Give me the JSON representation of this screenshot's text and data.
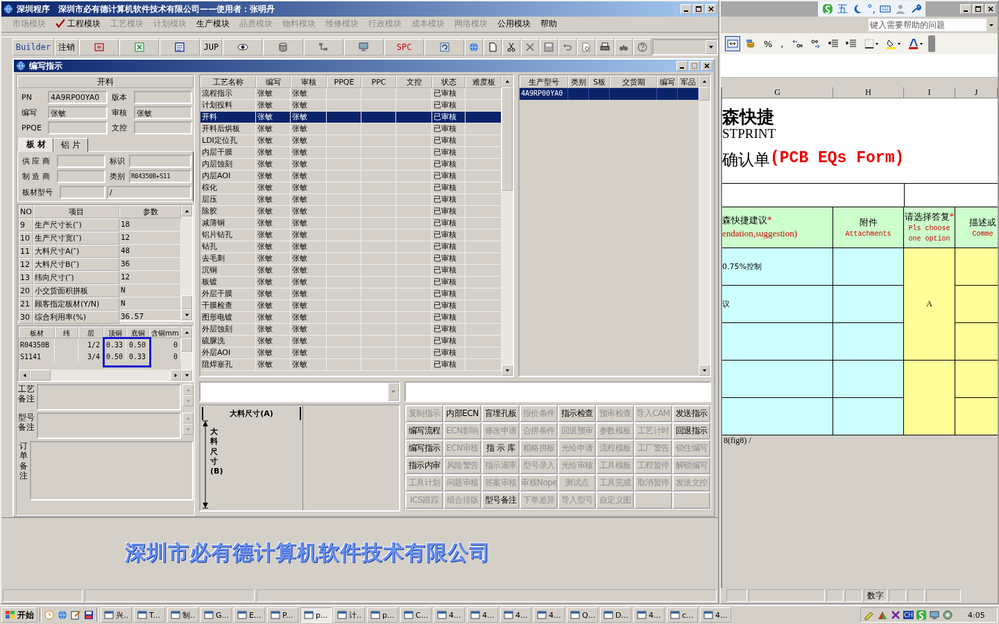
{
  "main_window": {
    "title": "深圳程序　深圳市必有德计算机软件技术有限公司——使用者：张明丹",
    "menu": [
      {
        "label": "市场模块",
        "disabled": true,
        "checked": false
      },
      {
        "label": "工程模块",
        "disabled": false,
        "checked": true
      },
      {
        "label": "工艺模块",
        "disabled": true,
        "checked": false
      },
      {
        "label": "计划模块",
        "disabled": true,
        "checked": false
      },
      {
        "label": "生产模块",
        "disabled": false,
        "checked": false
      },
      {
        "label": "品质模块",
        "disabled": true,
        "checked": false
      },
      {
        "label": "物料模块",
        "disabled": true,
        "checked": false
      },
      {
        "label": "维修模块",
        "disabled": true,
        "checked": false
      },
      {
        "label": "行政模块",
        "disabled": true,
        "checked": false
      },
      {
        "label": "成本模块",
        "disabled": true,
        "checked": false
      },
      {
        "label": "网络模块",
        "disabled": true,
        "checked": false
      },
      {
        "label": "公用模块",
        "disabled": false,
        "checked": false
      },
      {
        "label": "帮助",
        "disabled": false,
        "checked": false
      }
    ],
    "toolbar": [
      {
        "kind": "text",
        "label": "Builder"
      },
      {
        "kind": "text",
        "label": "注销"
      },
      {
        "kind": "icon"
      },
      {
        "kind": "icon"
      },
      {
        "kind": "icon"
      },
      {
        "kind": "text",
        "label": "JUP"
      },
      {
        "kind": "icon"
      },
      {
        "kind": "icon"
      },
      {
        "kind": "icon"
      },
      {
        "kind": "icon"
      },
      {
        "kind": "text",
        "label": "SPC"
      },
      {
        "kind": "icon"
      },
      {
        "kind": "icon"
      },
      {
        "kind": "icon"
      },
      {
        "kind": "icon"
      },
      {
        "kind": "icon"
      },
      {
        "kind": "icon"
      },
      {
        "kind": "icon"
      },
      {
        "kind": "icon"
      },
      {
        "kind": "icon"
      },
      {
        "kind": "icon"
      },
      {
        "kind": "icon"
      }
    ],
    "banner": "深圳市必有德计算机软件技术有限公司"
  },
  "child_window": {
    "title": "编写指示",
    "left_panel": {
      "header": "开料",
      "fields": [
        {
          "label": "PN",
          "value": "4A9RP00YA0"
        },
        {
          "label": "版本"
        },
        {
          "label": "编写",
          "value": "张敏"
        },
        {
          "label": "审核",
          "value": "张敏"
        },
        {
          "label": "PPQE"
        },
        {
          "label": "文控"
        }
      ],
      "tabs": [
        {
          "label": "板 材",
          "selected": true
        },
        {
          "label": "铝 片",
          "selected": false
        }
      ],
      "material_fields": [
        {
          "label": "供 应 商"
        },
        {
          "label": "标识"
        },
        {
          "label": "制 造 商"
        },
        {
          "label": "类别",
          "value": "R04350B+S11"
        }
      ],
      "board_model": {
        "label": "板材型号",
        "value_2": "/"
      },
      "params": {
        "columns": [
          "NO",
          "项目",
          "参数"
        ],
        "rows": [
          [
            "9",
            "生产尺寸长(″)",
            "18"
          ],
          [
            "10",
            "生产尺寸宽(″)",
            "12"
          ],
          [
            "11",
            "大料尺寸A(″)",
            "48"
          ],
          [
            "12",
            "大料尺寸B(″)",
            "36"
          ],
          [
            "13",
            "纬向尺寸(″)",
            "12"
          ],
          [
            "20",
            "小交货面积拼板",
            "N"
          ],
          [
            "21",
            "顾客指定板材(Y/N)",
            "N"
          ],
          [
            "30",
            "综合利用率(%)",
            "36.57"
          ]
        ]
      },
      "materials": {
        "columns": [
          "板材",
          "纬",
          "层",
          "顶铜",
          "底铜",
          "含铜mm"
        ],
        "rows": [
          [
            "R04350B",
            "",
            "1/2",
            "0.33",
            "0.50",
            "0"
          ],
          [
            "S1141",
            "",
            "3/4",
            "0.50",
            "0.33",
            "0"
          ]
        ]
      },
      "remarks": [
        {
          "label": "工艺备注",
          "kind": "small"
        },
        {
          "label": "型号备注",
          "kind": "small"
        },
        {
          "label": "订单备注",
          "kind": "large"
        }
      ]
    },
    "process_table": {
      "columns": [
        "工艺名称",
        "编写",
        "审核",
        "PPQE",
        "PPC",
        "文控",
        "状态",
        "难度板"
      ],
      "rows": [
        {
          "name": "流程指示",
          "writer": "张敏",
          "reviewer": "张敏",
          "status": "已审核",
          "selected": false
        },
        {
          "name": "计划投料",
          "writer": "张敏",
          "reviewer": "张敏",
          "status": "已审核",
          "selected": false
        },
        {
          "name": "开料",
          "writer": "张敏",
          "reviewer": "张敏",
          "status": "已审核",
          "selected": true
        },
        {
          "name": "开料后烘板",
          "writer": "张敏",
          "reviewer": "张敏",
          "status": "已审核",
          "selected": false
        },
        {
          "name": "LDI定位孔",
          "writer": "张敏",
          "reviewer": "张敏",
          "status": "已审核",
          "selected": false
        },
        {
          "name": "内层干膜",
          "writer": "张敏",
          "reviewer": "张敏",
          "status": "已审核",
          "selected": false
        },
        {
          "name": "内层蚀刻",
          "writer": "张敏",
          "reviewer": "张敏",
          "status": "已审核",
          "selected": false
        },
        {
          "name": "内层AOI",
          "writer": "张敏",
          "reviewer": "张敏",
          "status": "已审核",
          "selected": false
        },
        {
          "name": "棕化",
          "writer": "张敏",
          "reviewer": "张敏",
          "status": "已审核",
          "selected": false
        },
        {
          "name": "层压",
          "writer": "张敏",
          "reviewer": "张敏",
          "status": "已审核",
          "selected": false
        },
        {
          "name": "除胶",
          "writer": "张敏",
          "reviewer": "张敏",
          "status": "已审核",
          "selected": false
        },
        {
          "name": "减薄铜",
          "writer": "张敏",
          "reviewer": "张敏",
          "status": "已审核",
          "selected": false
        },
        {
          "name": "铝片钻孔",
          "writer": "张敏",
          "reviewer": "张敏",
          "status": "已审核",
          "selected": false
        },
        {
          "name": "钻孔",
          "writer": "张敏",
          "reviewer": "张敏",
          "status": "已审核",
          "selected": false
        },
        {
          "name": "去毛刺",
          "writer": "张敏",
          "reviewer": "张敏",
          "status": "已审核",
          "selected": false
        },
        {
          "name": "沉铜",
          "writer": "张敏",
          "reviewer": "张敏",
          "status": "已审核",
          "selected": false
        },
        {
          "name": "板镀",
          "writer": "张敏",
          "reviewer": "张敏",
          "status": "已审核",
          "selected": false
        },
        {
          "name": "外层干膜",
          "writer": "张敏",
          "reviewer": "张敏",
          "status": "已审核",
          "selected": false
        },
        {
          "name": "干膜检查",
          "writer": "张敏",
          "reviewer": "张敏",
          "status": "已审核",
          "selected": false
        },
        {
          "name": "图形电镀",
          "writer": "张敏",
          "reviewer": "张敏",
          "status": "已审核",
          "selected": false
        },
        {
          "name": "外层蚀刻",
          "writer": "张敏",
          "reviewer": "张敏",
          "status": "已审核",
          "selected": false
        },
        {
          "name": "硫脲洗",
          "writer": "张敏",
          "reviewer": "张敏",
          "status": "已审核",
          "selected": false
        },
        {
          "name": "外层AOI",
          "writer": "张敏",
          "reviewer": "张敏",
          "status": "已审核",
          "selected": false
        },
        {
          "name": "阻焊塞孔",
          "writer": "张敏",
          "reviewer": "张敏",
          "status": "已审核",
          "selected": false
        }
      ]
    },
    "model_table": {
      "columns": [
        "生产型号",
        "类别",
        "S板",
        "交货期",
        "编写",
        "军品"
      ],
      "rows": [
        {
          "model": "4A9RP00YA0",
          "selected": true
        }
      ]
    },
    "diagram": {
      "width_label": "大料尺寸(A)",
      "height_label": "大料尺寸(B)"
    },
    "buttons": [
      [
        {
          "label": "复制指示",
          "disabled": true
        },
        {
          "label": "内部ECN",
          "disabled": false
        },
        {
          "label": "盲埋孔板",
          "disabled": false
        },
        {
          "label": "报价条件",
          "disabled": true
        },
        {
          "label": "指示检查",
          "disabled": false
        },
        {
          "label": "预审检查",
          "disabled": true
        },
        {
          "label": "导入CAM",
          "disabled": true
        },
        {
          "label": "发送指示",
          "disabled": false
        }
      ],
      [
        {
          "label": "编写流程",
          "disabled": false
        },
        {
          "label": "ECN影响",
          "disabled": true
        },
        {
          "label": "修改申请",
          "disabled": true
        },
        {
          "label": "合拼条件",
          "disabled": true
        },
        {
          "label": "回退预审",
          "disabled": true
        },
        {
          "label": "参数模板",
          "disabled": true
        },
        {
          "label": "工艺计时",
          "disabled": true
        },
        {
          "label": "回退指示",
          "disabled": false
        }
      ],
      [
        {
          "label": "编写指示",
          "disabled": false
        },
        {
          "label": "ECN审核",
          "disabled": true
        },
        {
          "label": "指 示 库",
          "disabled": false
        },
        {
          "label": "粗略拼板",
          "disabled": true
        },
        {
          "label": "光绘申请",
          "disabled": true
        },
        {
          "label": "流程模板",
          "disabled": true
        },
        {
          "label": "工厂警告",
          "disabled": true
        },
        {
          "label": "锁住编写",
          "disabled": true
        }
      ],
      [
        {
          "label": "指示内审",
          "disabled": false
        },
        {
          "label": "风险警告",
          "disabled": true
        },
        {
          "label": "指示退率",
          "disabled": true
        },
        {
          "label": "型号录入",
          "disabled": true
        },
        {
          "label": "光绘审核",
          "disabled": true
        },
        {
          "label": "工具模板",
          "disabled": true
        },
        {
          "label": "工程暂停",
          "disabled": true
        },
        {
          "label": "解锁编写",
          "disabled": true
        }
      ],
      [
        {
          "label": "工具计划",
          "disabled": true
        },
        {
          "label": "问题审核",
          "disabled": true
        },
        {
          "label": "答案审核",
          "disabled": true
        },
        {
          "label": "审核Nope",
          "disabled": true
        },
        {
          "label": "测试点",
          "disabled": true
        },
        {
          "label": "工具完成",
          "disabled": true
        },
        {
          "label": "取消暂停",
          "disabled": true
        },
        {
          "label": "发送文控",
          "disabled": true
        }
      ],
      [
        {
          "label": "ICS跟踪",
          "disabled": true
        },
        {
          "label": "组合排版",
          "disabled": true
        },
        {
          "label": "型号备注",
          "disabled": false
        },
        {
          "label": "下单差异",
          "disabled": true
        },
        {
          "label": "导入型号",
          "disabled": true
        },
        {
          "label": "自定义图",
          "disabled": true
        }
      ]
    ]
  },
  "excel_window": {
    "ime_bar": [
      "五",
      "°,"
    ],
    "help_placeholder": "键入需要帮助的问题",
    "toolbar": [
      {
        "kind": "icon"
      },
      {
        "kind": "icon"
      },
      {
        "kind": "text",
        "label": "%"
      },
      {
        "kind": "text",
        "label": ","
      },
      {
        "kind": "icon"
      },
      {
        "kind": "icon"
      },
      {
        "kind": "icon"
      },
      {
        "kind": "icon"
      },
      {
        "kind": "icon"
      },
      {
        "kind": "icon"
      },
      {
        "kind": "icon"
      }
    ],
    "columns": [
      "G",
      "H",
      "I",
      "J"
    ],
    "brand_cn": "森快捷",
    "brand_en": "STPRINT",
    "form_title": "确认单",
    "form_title_en": "(PCB EQs Form)",
    "headers": [
      {
        "cn": "森快捷建议",
        "mark": "*",
        "en": "endation,suggestion)"
      },
      {
        "cn": "附件",
        "en": "Attachments"
      },
      {
        "cn": "请选择答复",
        "mark": "*",
        "en": "Pls choose one option"
      },
      {
        "cn": "描述或",
        "en": "Comme"
      }
    ],
    "rows": [
      {
        "suggestion": "0.75%控制"
      },
      {
        "suggestion": "议"
      },
      {},
      {},
      {}
    ],
    "answer": "A",
    "sheet_tab": "8(fig8) /",
    "status": "数字"
  },
  "taskbar": {
    "start": "开始",
    "items": [
      {
        "label": "兴..",
        "selected": false
      },
      {
        "label": "T...",
        "selected": false
      },
      {
        "label": "制..",
        "selected": false
      },
      {
        "label": "G...",
        "selected": false
      },
      {
        "label": "E...",
        "selected": false
      },
      {
        "label": "P...",
        "selected": false
      },
      {
        "label": "p...",
        "selected": true
      },
      {
        "label": "计..",
        "selected": false
      },
      {
        "label": "p...",
        "selected": false
      },
      {
        "label": "C...",
        "selected": false
      },
      {
        "label": "4...",
        "selected": false
      },
      {
        "label": "4...",
        "selected": false
      },
      {
        "label": "4...",
        "selected": false
      },
      {
        "label": "4...",
        "selected": false
      },
      {
        "label": "Q...",
        "selected": false
      },
      {
        "label": "D...",
        "selected": false
      },
      {
        "label": "4...",
        "selected": false
      },
      {
        "label": "c...",
        "selected": false
      },
      {
        "label": "4...",
        "selected": false
      }
    ],
    "tray_lang": "CH",
    "clock": "4:05"
  }
}
